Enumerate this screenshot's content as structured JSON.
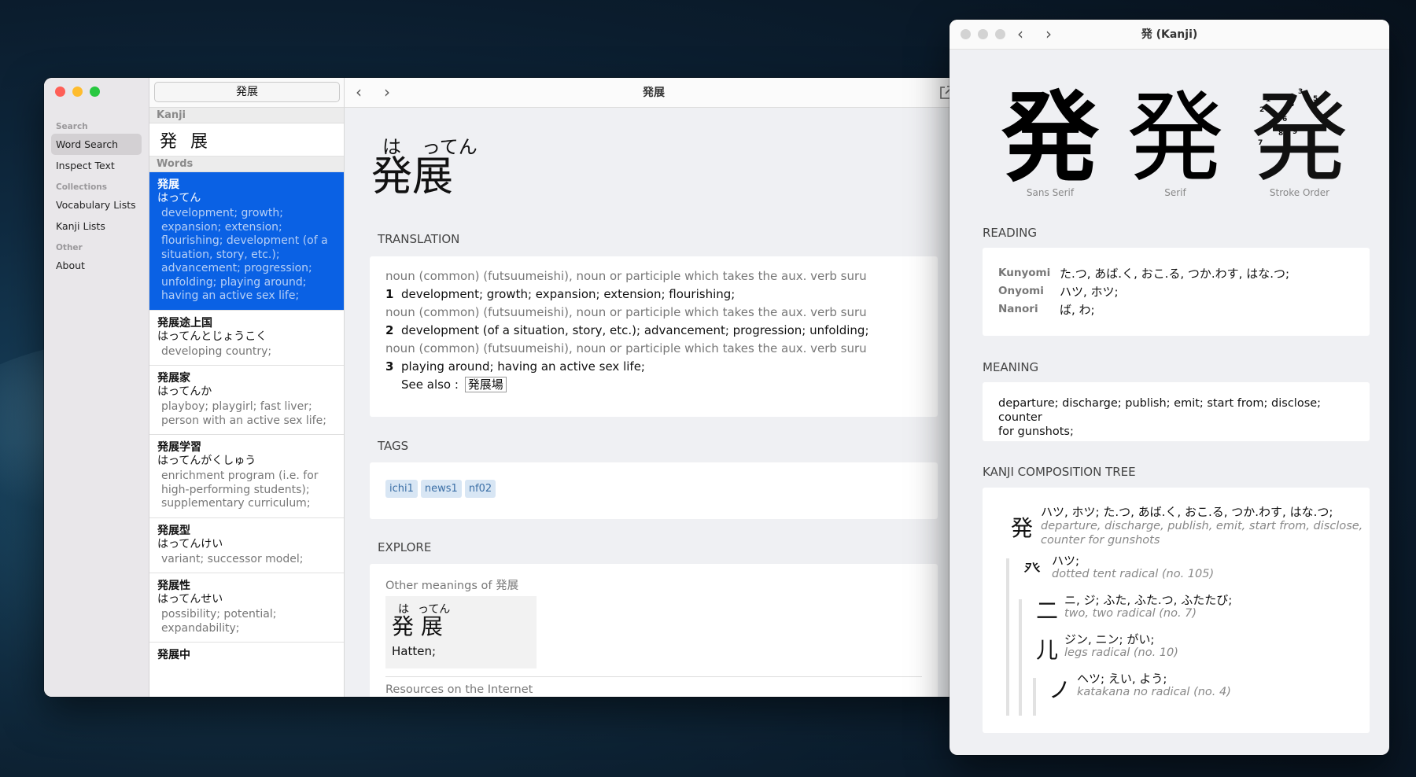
{
  "main_window": {
    "title": "発展",
    "search_value": "発展",
    "sidebar": {
      "sections": [
        {
          "label": "Search",
          "items": [
            {
              "label": "Word Search",
              "selected": true
            },
            {
              "label": "Inspect Text"
            }
          ]
        },
        {
          "label": "Collections",
          "items": [
            {
              "label": "Vocabulary Lists"
            },
            {
              "label": "Kanji Lists"
            }
          ]
        },
        {
          "label": "Other",
          "items": [
            {
              "label": "About"
            }
          ]
        }
      ]
    },
    "list": {
      "kanji_header": "Kanji",
      "kanji": [
        "発",
        "展"
      ],
      "words_header": "Words",
      "entries": [
        {
          "word": "発展",
          "reading": "はってん",
          "gloss": [
            "development; growth;",
            "expansion; extension;",
            "flourishing; development (of a",
            "situation, story, etc.);",
            "advancement; progression;",
            "unfolding; playing around;",
            "having an active sex life;"
          ],
          "selected": true
        },
        {
          "word": "発展途上国",
          "reading": "はってんとじょうこく",
          "gloss": [
            "developing country;"
          ]
        },
        {
          "word": "発展家",
          "reading": "はってんか",
          "gloss": [
            "playboy; playgirl; fast liver;",
            "person with an active sex life;"
          ]
        },
        {
          "word": "発展学習",
          "reading": "はってんがくしゅう",
          "gloss": [
            "enrichment program (i.e. for",
            "high-performing students);",
            "supplementary curriculum;"
          ]
        },
        {
          "word": "発展型",
          "reading": "はってんけい",
          "gloss": [
            "variant; successor model;"
          ]
        },
        {
          "word": "発展性",
          "reading": "はってんせい",
          "gloss": [
            "possibility; potential;",
            "expandability;"
          ]
        },
        {
          "word": "発展中",
          "reading": "",
          "gloss": []
        }
      ]
    },
    "detail": {
      "furigana_1": "は",
      "furigana_2": "ってん",
      "headword_1": "発",
      "headword_2": "展",
      "translation_header": "TRANSLATION",
      "pos": "noun (common) (futsuumeishi), noun or participle which takes the aux. verb suru",
      "senses": [
        {
          "num": "1",
          "text": "development; growth; expansion; extension; flourishing;"
        },
        {
          "num": "2",
          "text": "development (of a situation, story, etc.); advancement; progression; unfolding;"
        },
        {
          "num": "3",
          "text": "playing around; having an active sex life;"
        }
      ],
      "see_also_label": "See also :",
      "see_also_link": "発展場",
      "tags_header": "TAGS",
      "tags": [
        "ichi1",
        "news1",
        "nf02"
      ],
      "explore_header": "EXPLORE",
      "other_meanings_label": "Other meanings of 発展",
      "other_furigana_1": "は",
      "other_furigana_2": "ってん",
      "other_word": "発 展",
      "other_gloss": "Hatten;",
      "resources_label": "Resources on the Internet"
    }
  },
  "kanji_window": {
    "title": "発 (Kanji)",
    "glyph": "発",
    "captions": [
      "Sans Serif",
      "Serif",
      "Stroke Order"
    ],
    "stroke_numbers": [
      "1",
      "2",
      "3",
      "4",
      "5",
      "6",
      "7",
      "8",
      "9"
    ],
    "reading_header": "READING",
    "readings": [
      {
        "label": "Kunyomi",
        "value": "た.つ, あば.く, おこ.る, つか.わす, はな.つ;"
      },
      {
        "label": "Onyomi",
        "value": "ハツ, ホツ;"
      },
      {
        "label": "Nanori",
        "value": "ば, わ;"
      }
    ],
    "meaning_header": "MEANING",
    "meaning_1": "departure; discharge; publish; emit; start from; disclose; counter",
    "meaning_2": "for gunshots;",
    "tree_header": "KANJI COMPOSITION TREE",
    "tree": [
      {
        "glyph": "発",
        "reading": "ハツ, ホツ; た.つ, あば.く, おこ.る, つか.わす, はな.つ;",
        "meaning_1": "departure, discharge, publish, emit, start from, disclose,",
        "meaning_2": "counter for gunshots"
      },
      {
        "glyph": "癶",
        "reading": "ハツ;",
        "meaning_1": "dotted tent radical (no. 105)"
      },
      {
        "glyph": "二",
        "reading": "ニ, ジ; ふた, ふた.つ, ふたたび;",
        "meaning_1": "two, two radical (no. 7)"
      },
      {
        "glyph": "儿",
        "reading": "ジン, ニン; がい;",
        "meaning_1": "legs radical (no. 10)"
      },
      {
        "glyph": "ノ",
        "reading": "ヘツ; えい, よう;",
        "meaning_1": "katakana no radical (no. 4)"
      }
    ]
  },
  "colors": {
    "selection": "#0a61e4",
    "close": "#fe5f57",
    "minimize": "#febc2e",
    "zoom": "#28c840",
    "tag_bg": "#d8e6f4"
  }
}
